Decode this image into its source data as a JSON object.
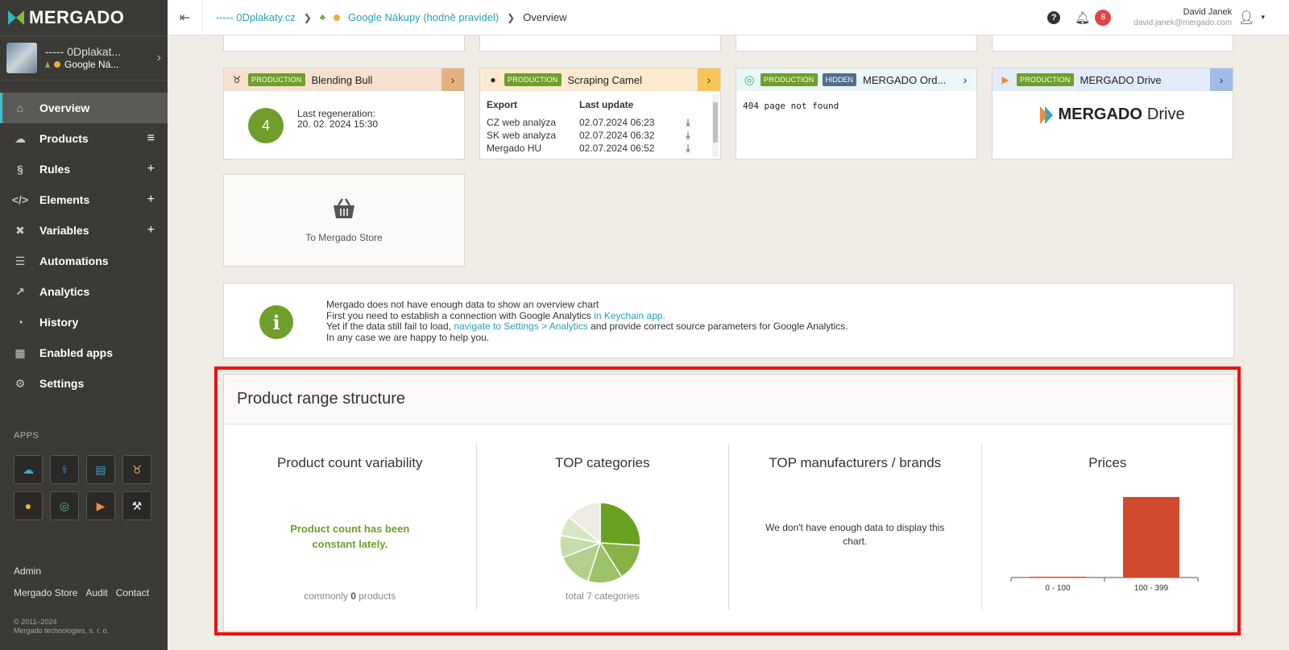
{
  "app": {
    "logo": "MERGADO"
  },
  "project": {
    "name": "----- 0Dplakat...",
    "sub": "Google Ná..."
  },
  "nav": [
    {
      "label": "Overview",
      "icon": "home-icon"
    },
    {
      "label": "Products",
      "icon": "products-icon"
    },
    {
      "label": "Rules",
      "icon": "rules-icon"
    },
    {
      "label": "Elements",
      "icon": "code-icon"
    },
    {
      "label": "Variables",
      "icon": "variables-icon"
    },
    {
      "label": "Automations",
      "icon": "automations-icon"
    },
    {
      "label": "Analytics",
      "icon": "analytics-icon"
    },
    {
      "label": "History",
      "icon": "history-icon"
    },
    {
      "label": "Enabled apps",
      "icon": "apps-grid-icon"
    },
    {
      "label": "Settings",
      "icon": "gear-icon"
    }
  ],
  "apps_title": "APPS",
  "footer": {
    "admin": "Admin",
    "store": "Mergado Store",
    "audit": "Audit",
    "contact": "Contact",
    "copyright1": "© 2011–2024",
    "copyright2": "Mergado technologies, s. r. o."
  },
  "topbar": {
    "crumb1": "----- 0Dplakaty.cz",
    "crumb2": "Google Nákupy (hodně pravidel)",
    "crumb3": "Overview",
    "help": "?",
    "notifications": "8",
    "user_name": "David Janek",
    "user_email": "david.janek@mergado.com"
  },
  "cards": {
    "production_tag": "PRODUCTION",
    "hidden_tag": "HIDDEN",
    "bull": {
      "name": "Blending Bull",
      "count": "4",
      "regen_label": "Last regeneration:",
      "regen_date": "20. 02. 2024 15:30"
    },
    "camel": {
      "name": "Scraping Camel",
      "col_export": "Export",
      "col_update": "Last update",
      "rows": [
        {
          "export": "CZ web analýza",
          "update": "02.07.2024 06:23"
        },
        {
          "export": "SK web analyza",
          "update": "02.07.2024 06:32"
        },
        {
          "export": "Mergado HU",
          "update": "02.07.2024 06:52"
        }
      ]
    },
    "orders": {
      "name": "MERGADO Ord...",
      "message": "404 page not found"
    },
    "drive": {
      "name": "MERGADO Drive",
      "logo_bold": "MERGADO",
      "logo_light": "Drive"
    },
    "store": {
      "label": "To Mergado Store"
    }
  },
  "info": {
    "line1": "Mergado does not have enough data to show an overview chart",
    "line2_pre": "First you need to establish a connection with Google Analytics ",
    "line2_link": "in Keychain app.",
    "line3_pre": "Yet if the data still fail to load, ",
    "line3_link": "navigate to Settings > Analytics",
    "line3_post": " and provide correct source parameters for Google Analytics.",
    "line4": "In any case we are happy to help you."
  },
  "range": {
    "title": "Product range structure",
    "variability": {
      "title": "Product count variability",
      "message": "Product count has been constant lately.",
      "foot_pre": "commonly ",
      "foot_num": "0",
      "foot_post": " products"
    },
    "categories": {
      "title": "TOP categories",
      "foot": "total 7 categories"
    },
    "manufacturers": {
      "title": "TOP manufacturers / brands",
      "message": "We don't have enough data to display this chart."
    },
    "prices": {
      "title": "Prices"
    }
  },
  "chart_data": [
    {
      "type": "pie",
      "title": "TOP categories",
      "values": [
        26,
        15,
        14,
        14,
        9,
        8,
        14
      ],
      "colors": [
        "#6ba121",
        "#87b246",
        "#9ec26b",
        "#b3cf8e",
        "#c6dcab",
        "#d6e6c5",
        "#eeebe4"
      ]
    },
    {
      "type": "bar",
      "title": "Prices",
      "categories": [
        "0 - 100",
        "100 - 399"
      ],
      "values": [
        1,
        100
      ],
      "color": "#d24a2e"
    }
  ]
}
